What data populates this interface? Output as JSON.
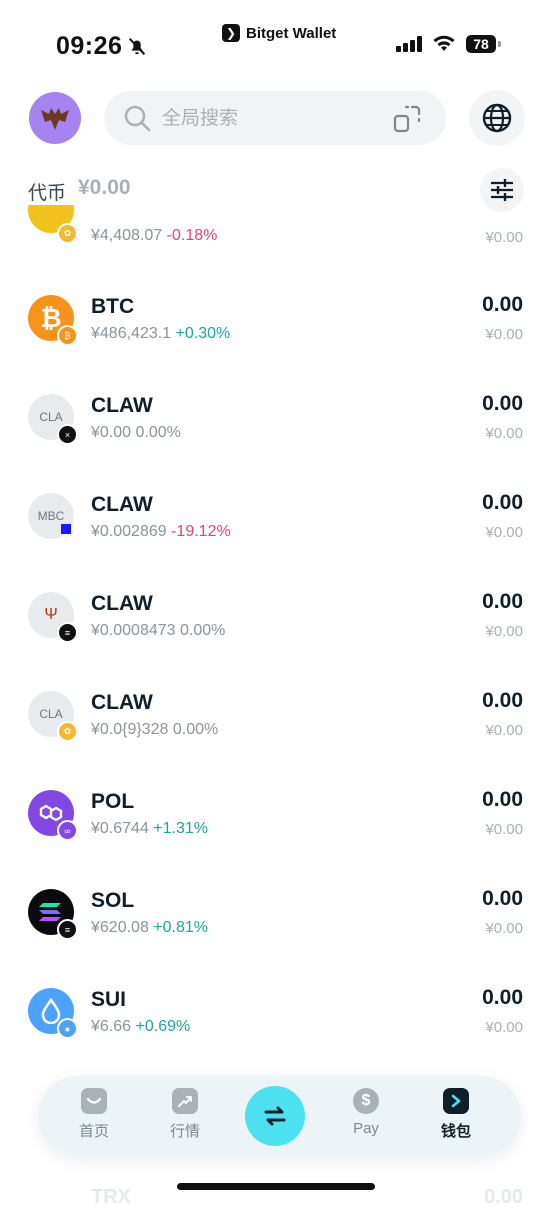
{
  "status_bar": {
    "time": "09:26",
    "brand": "Bitget Wallet",
    "battery": "78"
  },
  "search": {
    "placeholder": "全局搜索"
  },
  "token_header": {
    "tab": "代币",
    "total": "¥0.00"
  },
  "tokens": [
    {
      "symbol": "",
      "price": "¥4,408.07",
      "change": "-0.18%",
      "balance": "",
      "fiat": "¥0.00"
    },
    {
      "symbol": "BTC",
      "price": "¥486,423.1",
      "change": "+0.30%",
      "balance": "0.00",
      "fiat": "¥0.00"
    },
    {
      "symbol": "CLAW",
      "icon_text": "CLA",
      "price": "¥0.00",
      "change": "0.00%",
      "balance": "0.00",
      "fiat": "¥0.00"
    },
    {
      "symbol": "CLAW",
      "icon_text": "MBC",
      "price": "¥0.002869",
      "change": "-19.12%",
      "balance": "0.00",
      "fiat": "¥0.00"
    },
    {
      "symbol": "CLAW",
      "price": "¥0.0008473",
      "change": "0.00%",
      "balance": "0.00",
      "fiat": "¥0.00"
    },
    {
      "symbol": "CLAW",
      "icon_text": "CLA",
      "price": "¥0.0{9}328",
      "change": "0.00%",
      "balance": "0.00",
      "fiat": "¥0.00"
    },
    {
      "symbol": "POL",
      "price": "¥0.6744",
      "change": "+1.31%",
      "balance": "0.00",
      "fiat": "¥0.00"
    },
    {
      "symbol": "SOL",
      "price": "¥620.08",
      "change": "+0.81%",
      "balance": "0.00",
      "fiat": "¥0.00"
    },
    {
      "symbol": "SUI",
      "price": "¥6.66",
      "change": "+0.69%",
      "balance": "0.00",
      "fiat": "¥0.00"
    }
  ],
  "partial_row": {
    "symbol": "TRX",
    "balance": "0.00"
  },
  "nav": {
    "home": "首页",
    "market": "行情",
    "pay": "Pay",
    "wallet": "钱包"
  },
  "colors": {
    "positive": "#1fa3a0",
    "negative": "#e0457b",
    "accent": "#4de0f0"
  }
}
